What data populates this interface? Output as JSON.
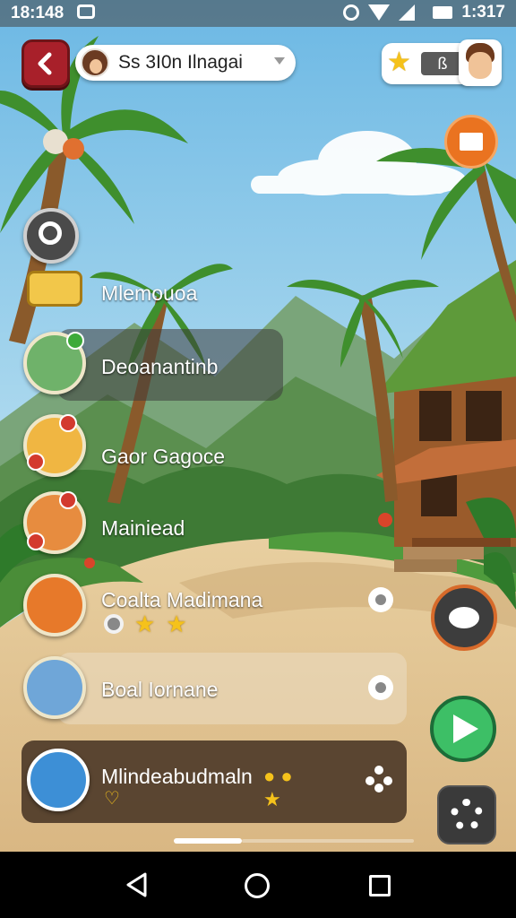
{
  "status_bar": {
    "time_left": "18:148",
    "time_right": "1:317"
  },
  "header": {
    "profile_name": "Ss 3I0n Ilnagai",
    "score_value": "ß"
  },
  "menu": [
    {
      "id": "search",
      "label": ""
    },
    {
      "id": "memo",
      "label": "Mlemouoa"
    },
    {
      "id": "decoration",
      "label": "Deoanantinb"
    },
    {
      "id": "games",
      "label": "Gaor Gagoce"
    },
    {
      "id": "married",
      "label": "Mainiead"
    },
    {
      "id": "coalta",
      "label": "Coalta Madimana"
    },
    {
      "id": "boal",
      "label": "Boal Iornane"
    },
    {
      "id": "hero",
      "label": "Mlindeabudmaln"
    }
  ],
  "stars": {
    "rating": 2,
    "max": 2
  },
  "colors": {
    "back_button": "#a8202a",
    "mail_button": "#ea7320",
    "play_button": "#3dbf66",
    "chat_border": "#d76a2a",
    "star": "#f5c21b"
  },
  "icons": {
    "back": "chevron-left-icon",
    "mail": "mail-icon",
    "chat": "chat-bubble-icon",
    "play": "play-icon",
    "settings": "gear-icon"
  }
}
